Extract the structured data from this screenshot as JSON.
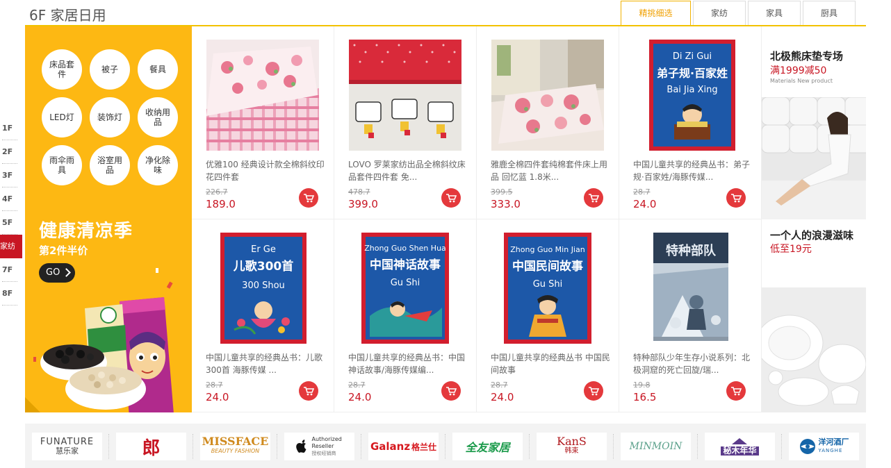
{
  "floor_nav": [
    "1F",
    "2F",
    "3F",
    "4F",
    "5F",
    "家纺",
    "7F",
    "8F"
  ],
  "floor_title": "6F 家居日用",
  "tabs": [
    "精挑细选",
    "家纺",
    "家具",
    "厨具"
  ],
  "promo": {
    "categories": [
      "床品套件",
      "被子",
      "餐具",
      "LED灯",
      "装饰灯",
      "收纳用品",
      "雨伞雨具",
      "浴室用品",
      "净化除味"
    ],
    "title": "健康清凉季",
    "subtitle": "第2件半价",
    "go_label": "GO"
  },
  "products": [
    {
      "name": "优雅100 经典设计款全棉斜纹印花四件套",
      "old_price": "226.7",
      "price": "189.0",
      "image": "pink-floral-bedding"
    },
    {
      "name": "LOVO 罗莱家纺出品全棉斜纹床品套件四件套 免...",
      "old_price": "478.7",
      "price": "399.0",
      "image": "red-cartoon-bedding"
    },
    {
      "name": "雅鹿全棉四件套纯棉套件床上用品 回忆蓝 1.8米...",
      "old_price": "399.5",
      "price": "333.0",
      "image": "floral-bedroom-set"
    },
    {
      "name": "中国儿童共享的经典丛书：弟子规·百家姓/海豚传媒...",
      "old_price": "28.7",
      "price": "24.0",
      "image": "book-dizigui"
    },
    {
      "name": "中国儿童共享的经典丛书：儿歌300首 海豚传媒 ...",
      "old_price": "28.7",
      "price": "24.0",
      "image": "book-erge"
    },
    {
      "name": "中国儿童共享的经典丛书：中国神话故事/海豚传媒编...",
      "old_price": "28.7",
      "price": "24.0",
      "image": "book-shenhua"
    },
    {
      "name": "中国儿童共享的经典丛书 中国民间故事",
      "old_price": "28.7",
      "price": "24.0",
      "image": "book-minjian"
    },
    {
      "name": "特种部队少年生存小说系列：北极洞窟的死亡回旋/瑞...",
      "old_price": "19.8",
      "price": "16.5",
      "image": "book-tezhongbudui"
    }
  ],
  "books": {
    "dizigui": {
      "pinyin1": "Di Zi Gui",
      "title": "弟子规·百家姓",
      "pinyin2": "Bai Jia Xing"
    },
    "erge": {
      "pinyin1": "Er Ge",
      "title": "儿歌300首",
      "pinyin2": "300 Shou"
    },
    "shenhua": {
      "pinyin1": "Zhong Guo Shen Hua",
      "title": "中国神话故事",
      "pinyin2": "Gu Shi"
    },
    "minjian": {
      "pinyin1": "Zhong Guo Min Jian",
      "title": "中国民间故事",
      "pinyin2": "Gu Shi"
    },
    "tezhong": {
      "title": "特种部队"
    }
  },
  "ads": [
    {
      "title": "北极熊床垫专场",
      "sub": "满1999减50",
      "tiny": "Materials New product"
    },
    {
      "title": "一个人的浪漫滋味",
      "sub": "低至19元"
    }
  ],
  "brands": [
    {
      "name": "FUNATURE",
      "sub": "慧乐家",
      "color": "#444"
    },
    {
      "name": "郎",
      "color": "#c81623"
    },
    {
      "name": "MISSFACE",
      "sub": "BEAUTY FASHION",
      "color": "#d08a1e"
    },
    {
      "name": "Authorized Reseller",
      "sub": "授权经销商",
      "color": "#333"
    },
    {
      "name": "Galanz",
      "sub": "格兰仕",
      "color": "#d6181e"
    },
    {
      "name": "全友家居",
      "color": "#1a9a4a"
    },
    {
      "name": "KanS",
      "sub": "韩束",
      "color": "#b0191e"
    },
    {
      "name": "MINMOIN",
      "color": "#5aa08a"
    },
    {
      "name": "秘木年华",
      "color": "#5a3a8a"
    },
    {
      "name": "洋河酒厂",
      "sub": "YANGHE",
      "color": "#1565a8"
    }
  ],
  "colors": {
    "accent_yellow": "#fdb813",
    "price_red": "#c81623",
    "cart_red": "#e4393c"
  }
}
